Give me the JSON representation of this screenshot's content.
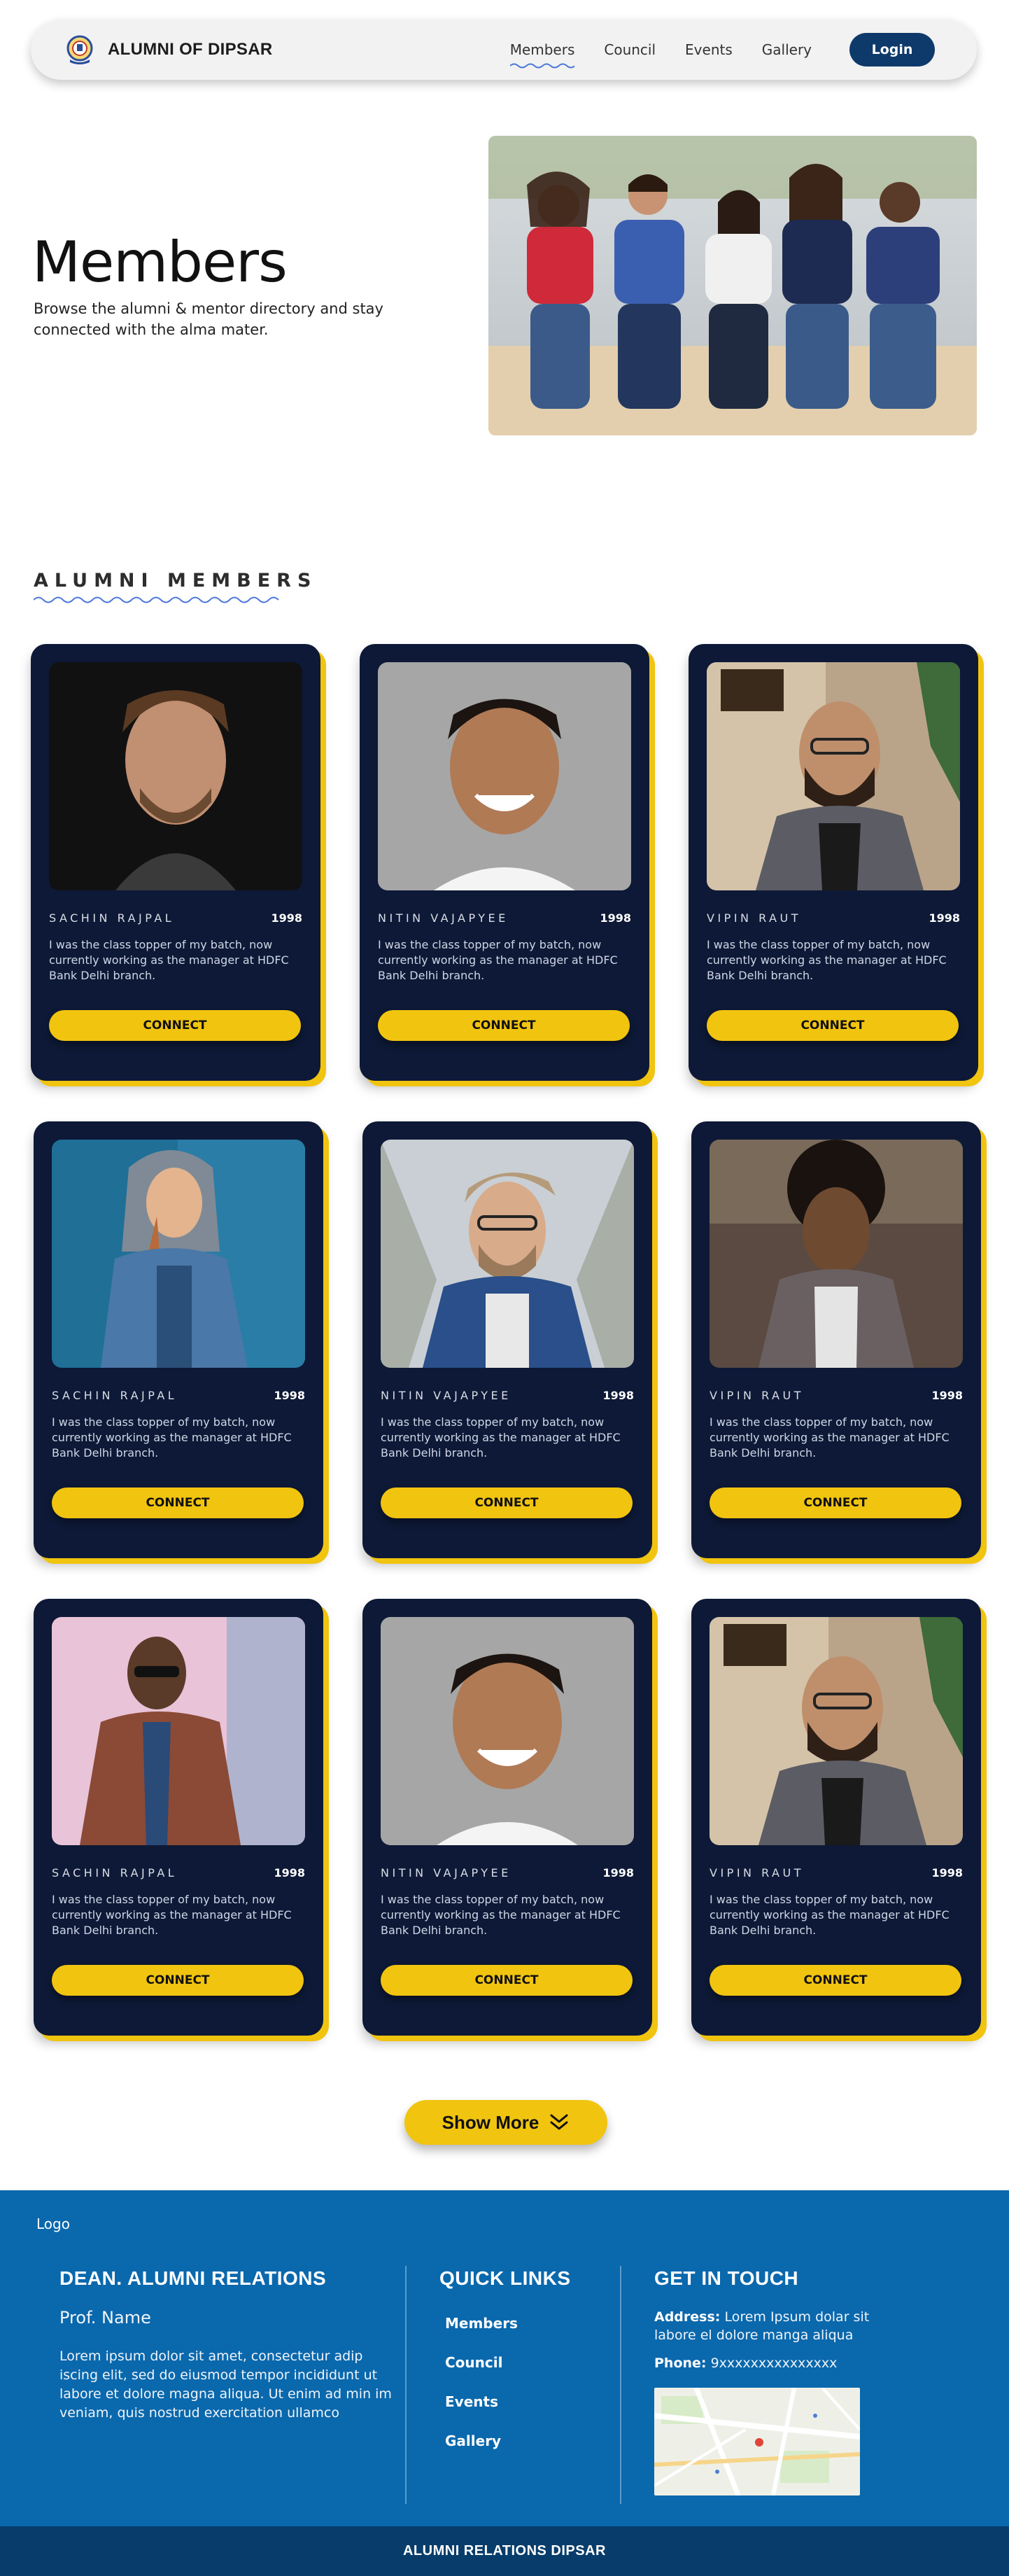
{
  "brand": {
    "name": "ALUMNI OF DIPSAR"
  },
  "nav": {
    "links": [
      "Members",
      "Council",
      "Events",
      "Gallery"
    ],
    "active": "Members",
    "login_label": "Login"
  },
  "hero": {
    "title": "Members",
    "text": "Browse the alumni & mentor directory and stay connected with the alma mater."
  },
  "section": {
    "title": "ALUMNI MEMBERS"
  },
  "members": [
    {
      "name": "SACHIN RAJPAL",
      "year": "1998",
      "desc": "I was the class topper of my batch, now currently working as the manager at HDFC Bank Delhi branch.",
      "button": "CONNECT"
    },
    {
      "name": "NITIN VAJAPYEE",
      "year": "1998",
      "desc": "I was the class topper of my batch, now currently working as the manager at HDFC Bank Delhi branch.",
      "button": "CONNECT"
    },
    {
      "name": "VIPIN RAUT",
      "year": "1998",
      "desc": "I was the class topper of my batch, now currently working as the manager at HDFC Bank Delhi branch.",
      "button": "CONNECT"
    },
    {
      "name": "SACHIN RAJPAL",
      "year": "1998",
      "desc": "I was the class topper of my batch, now currently working as the manager at HDFC Bank Delhi branch.",
      "button": "CONNECT"
    },
    {
      "name": "NITIN VAJAPYEE",
      "year": "1998",
      "desc": "I was the class topper of my batch, now currently working as the manager at HDFC Bank Delhi branch.",
      "button": "CONNECT"
    },
    {
      "name": "VIPIN RAUT",
      "year": "1998",
      "desc": "I was the class topper of my batch, now currently working as the manager at HDFC Bank Delhi branch.",
      "button": "CONNECT"
    },
    {
      "name": "SACHIN RAJPAL",
      "year": "1998",
      "desc": "I was the class topper of my batch, now currently working as the manager at HDFC Bank Delhi branch.",
      "button": "CONNECT"
    },
    {
      "name": "NITIN VAJAPYEE",
      "year": "1998",
      "desc": "I was the class topper of my batch, now currently working as the manager at HDFC Bank Delhi branch.",
      "button": "CONNECT"
    },
    {
      "name": "VIPIN RAUT",
      "year": "1998",
      "desc": "I was the class topper of my batch, now currently working as the manager at HDFC Bank Delhi branch.",
      "button": "CONNECT"
    }
  ],
  "show_more": {
    "label": "Show More",
    "icon": "double-chevron-down-icon"
  },
  "footer": {
    "logo": "Logo",
    "dean": {
      "title": "DEAN. ALUMNI RELATIONS",
      "name": "Prof. Name",
      "text": "Lorem ipsum dolor sit amet, consectetur adip iscing elit, sed do eiusmod tempor incididunt ut labore et dolore magna aliqua. Ut enim ad min im veniam, quis nostrud exercitation ullamco"
    },
    "quick_links": {
      "title": "QUICK LINKS",
      "items": [
        "Members",
        "Council",
        "Events",
        "Gallery"
      ]
    },
    "contact": {
      "title": "GET IN TOUCH",
      "address_label": "Address:",
      "address": "Lorem Ipsum dolar sit labore el dolore manga aliqua",
      "phone_label": "Phone:",
      "phone": "9xxxxxxxxxxxxxxx"
    },
    "bottom": "ALUMNI RELATIONS DIPSAR"
  },
  "colors": {
    "card_bg": "#0d1936",
    "accent_yellow": "#f1c40f",
    "login_blue": "#0e3a6b",
    "footer_blue": "#0a68ad",
    "bottom_bar": "#083d6b"
  }
}
